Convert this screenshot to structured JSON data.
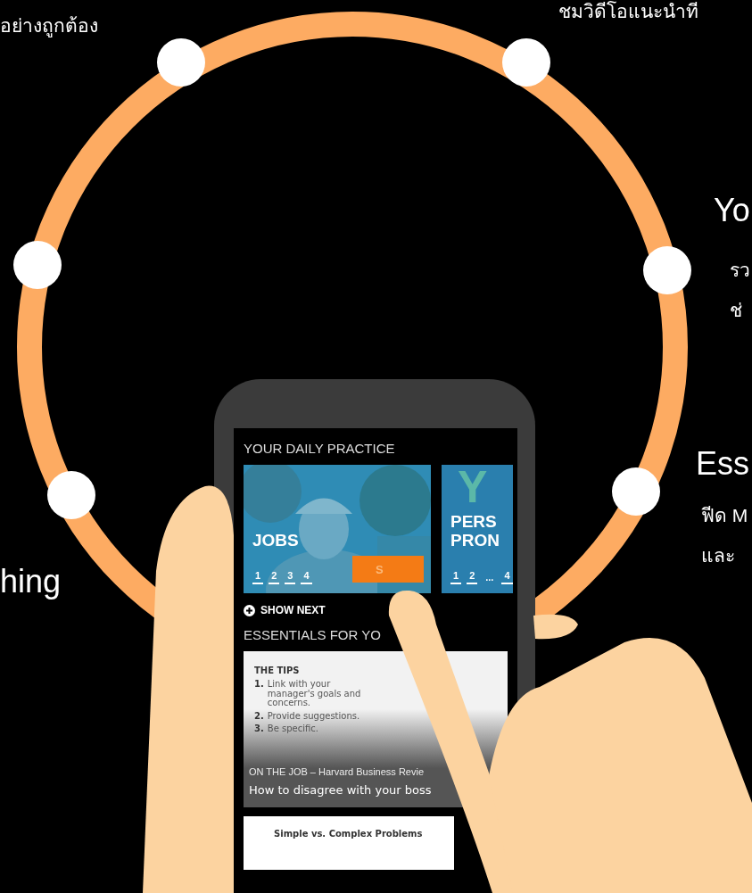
{
  "captions": [
    {
      "kind": "body",
      "text": "อย่างถูกต้อง"
    },
    {
      "kind": "body",
      "text": "ชมวิดีโอแนะนำที"
    },
    {
      "kind": "title",
      "text": "Yo"
    },
    {
      "kind": "body",
      "text": "รว"
    },
    {
      "kind": "body",
      "text": "ช่"
    },
    {
      "kind": "title",
      "text": "Ess"
    },
    {
      "kind": "body",
      "text": "ฟีด M"
    },
    {
      "kind": "body",
      "text": "และ"
    },
    {
      "kind": "title",
      "text": "hing"
    }
  ],
  "phone": {
    "practice_heading": "YOUR DAILY PRACTICE",
    "practice_cards": [
      {
        "title_lines": [
          "JOBS"
        ],
        "start_button": "S",
        "pages": [
          "1",
          "2",
          "3",
          "4"
        ]
      },
      {
        "kind": "letter",
        "letter": "Y",
        "title_lines": [
          "PERS",
          "PRON"
        ],
        "pages": [
          "1",
          "2",
          "...",
          "4"
        ]
      }
    ],
    "show_next": "SHOW NEXT",
    "essentials_heading": "ESSENTIALS FOR YO",
    "articles": [
      {
        "kind": "tips",
        "tips_title": "THE TIPS",
        "tips": [
          {
            "number": "1.",
            "text": "Link with your manager's goals and concerns."
          },
          {
            "number": "2.",
            "text": "Provide suggestions."
          },
          {
            "number": "3.",
            "text": "Be specific."
          }
        ],
        "category": "ON THE JOB – Harvard Business Revie",
        "title": "How to disagree with your boss"
      },
      {
        "kind": "plain",
        "heading": "Simple vs. Complex Problems"
      }
    ]
  }
}
